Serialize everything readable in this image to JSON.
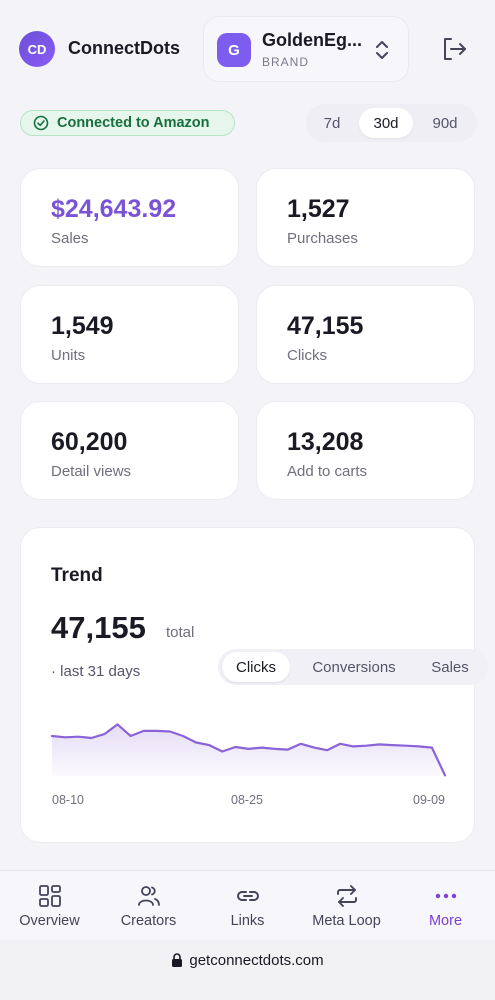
{
  "header": {
    "logo_initials": "CD",
    "app_name": "ConnectDots",
    "account": {
      "initial": "G",
      "name": "GoldenEg...",
      "type": "BRAND"
    },
    "logout_icon": "logout-icon"
  },
  "status": {
    "connected_label": "Connected to Amazon",
    "connected_icon": "check-circle-icon"
  },
  "range": {
    "options": [
      "7d",
      "30d",
      "90d"
    ],
    "selected": "30d"
  },
  "metrics": [
    {
      "value": "$24,643.92",
      "label": "Sales"
    },
    {
      "value": "1,527",
      "label": "Purchases"
    },
    {
      "value": "1,549",
      "label": "Units"
    },
    {
      "value": "47,155",
      "label": "Clicks"
    },
    {
      "value": "60,200",
      "label": "Detail views"
    },
    {
      "value": "13,208",
      "label": "Add to carts"
    }
  ],
  "trend": {
    "title": "Trend",
    "total": "47,155",
    "total_suffix": "total",
    "period": "· last 31 days",
    "tabs": [
      "Clicks",
      "Conversions",
      "Sales"
    ],
    "selected_tab": "Clicks"
  },
  "chart_data": {
    "type": "area",
    "series": [
      {
        "values": [
          1620,
          1600,
          1610,
          1590,
          1650,
          1800,
          1620,
          1700,
          1700,
          1690,
          1620,
          1520,
          1480,
          1380,
          1450,
          1420,
          1440,
          1420,
          1410,
          1500,
          1440,
          1400,
          1500,
          1460,
          1470,
          1490,
          1480,
          1470,
          1460,
          1440,
          1010
        ]
      }
    ],
    "x_tick_labels": [
      "08-10",
      "08-25",
      "09-09"
    ],
    "grid": false
  },
  "colors": {
    "accent": "#7b53d6",
    "line": "#8a63d8",
    "success": "#16703d"
  },
  "bottom_nav": [
    {
      "label": "Overview",
      "icon": "grid-icon"
    },
    {
      "label": "Creators",
      "icon": "users-icon"
    },
    {
      "label": "Links",
      "icon": "link-icon"
    },
    {
      "label": "Meta Loop",
      "icon": "repeat-icon"
    },
    {
      "label": "More",
      "icon": "more-dots-icon"
    }
  ],
  "nav_active": "More",
  "url_bar": {
    "url": "getconnectdots.com",
    "icon": "lock-icon"
  }
}
